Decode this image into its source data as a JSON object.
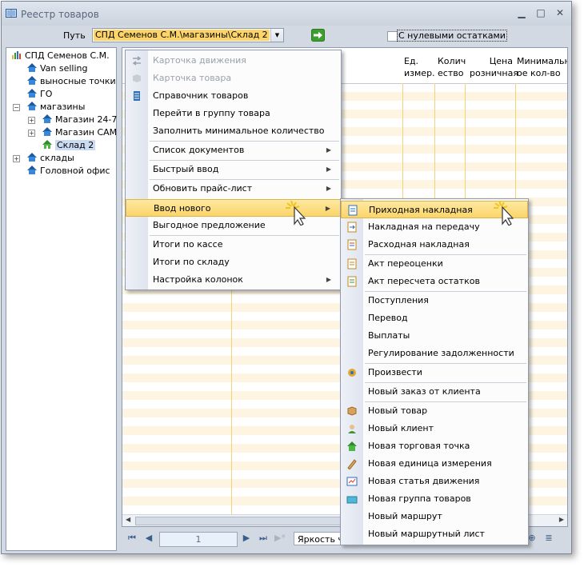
{
  "window": {
    "title": "Реестр товаров",
    "controls": {
      "minimize": "▁",
      "maximize": "□",
      "close": "✕"
    }
  },
  "path": {
    "label": "Путь",
    "value": "СПД Семенов С.М.\\магазины\\Склад 2",
    "zero_stock_label": "С нулевыми остатками",
    "zero_stock_checked": false
  },
  "tree": {
    "root": "СПД Семенов С.М.",
    "items": [
      {
        "label": "Van selling"
      },
      {
        "label": "выносные точки"
      },
      {
        "label": "ГО"
      },
      {
        "label": "магазины"
      },
      {
        "label": "Магазин 24-7"
      },
      {
        "label": "Магазин САМ"
      },
      {
        "label": "Склад 2"
      },
      {
        "label": "склады"
      },
      {
        "label": "Головной офис"
      }
    ]
  },
  "grid": {
    "columns": [
      "Ед. измер.",
      "Количество",
      "Цена розничная",
      "Минимальное кол-во"
    ],
    "col_lines": [
      [
        "Ед.",
        "измер."
      ],
      [
        "Колич",
        "ество"
      ],
      [
        "Цена",
        "розничная"
      ],
      [
        "Минимальн",
        "ое кол-во"
      ]
    ]
  },
  "nav": {
    "page": "1",
    "brightness_label": "Яркость че"
  },
  "context_menu": {
    "items": [
      {
        "label": "Карточка движения",
        "disabled": true,
        "icon": "movement-card-icon"
      },
      {
        "label": "Карточка товара",
        "disabled": true,
        "icon": "product-card-icon"
      },
      {
        "label": "Справочник товаров",
        "icon": "catalog-icon"
      },
      {
        "label": "Перейти в группу товара"
      },
      {
        "label": "Заполнить минимальное количество"
      },
      {
        "label": "Список документов",
        "submenu": true
      },
      {
        "label": "Быстрый ввод",
        "submenu": true
      },
      {
        "label": "Обновить прайс-лист",
        "submenu": true
      },
      {
        "label": "Ввод нового",
        "submenu": true,
        "highlighted": true
      },
      {
        "label": "Выгодное предложение"
      },
      {
        "label": "Итоги по кассе"
      },
      {
        "label": "Итоги по складу"
      },
      {
        "label": "Настройка колонок",
        "submenu": true
      }
    ]
  },
  "submenu": {
    "items": [
      {
        "label": "Приходная накладная",
        "icon": "incoming-invoice-icon",
        "highlighted": true
      },
      {
        "label": "Накладная на передачу",
        "icon": "transfer-invoice-icon"
      },
      {
        "label": "Расходная накладная",
        "icon": "outgoing-invoice-icon"
      },
      {
        "label": "Акт переоценки",
        "icon": "revaluation-icon"
      },
      {
        "label": "Акт пересчета остатков",
        "icon": "recount-icon"
      },
      {
        "label": "Поступления"
      },
      {
        "label": "Перевод"
      },
      {
        "label": "Выплаты"
      },
      {
        "label": "Регулирование задолженности"
      },
      {
        "label": "Произвести",
        "icon": "produce-icon"
      },
      {
        "label": "Новый заказ от клиента"
      },
      {
        "label": "Новый товар",
        "icon": "new-product-icon"
      },
      {
        "label": "Новый клиент",
        "icon": "new-client-icon"
      },
      {
        "label": "Новая торговая точка",
        "icon": "new-outlet-icon"
      },
      {
        "label": "Новая единица измерения",
        "icon": "new-unit-icon"
      },
      {
        "label": "Новая статья движения",
        "icon": "new-movement-item-icon"
      },
      {
        "label": "Новая группа товаров",
        "icon": "new-product-group-icon"
      },
      {
        "label": "Новый маршрут"
      },
      {
        "label": "Новый маршрутный лист"
      }
    ]
  },
  "colors": {
    "highlight": "#fbd56b",
    "path_value_bg": "#fcd468",
    "grid_stripe": "#fdf5e1"
  }
}
